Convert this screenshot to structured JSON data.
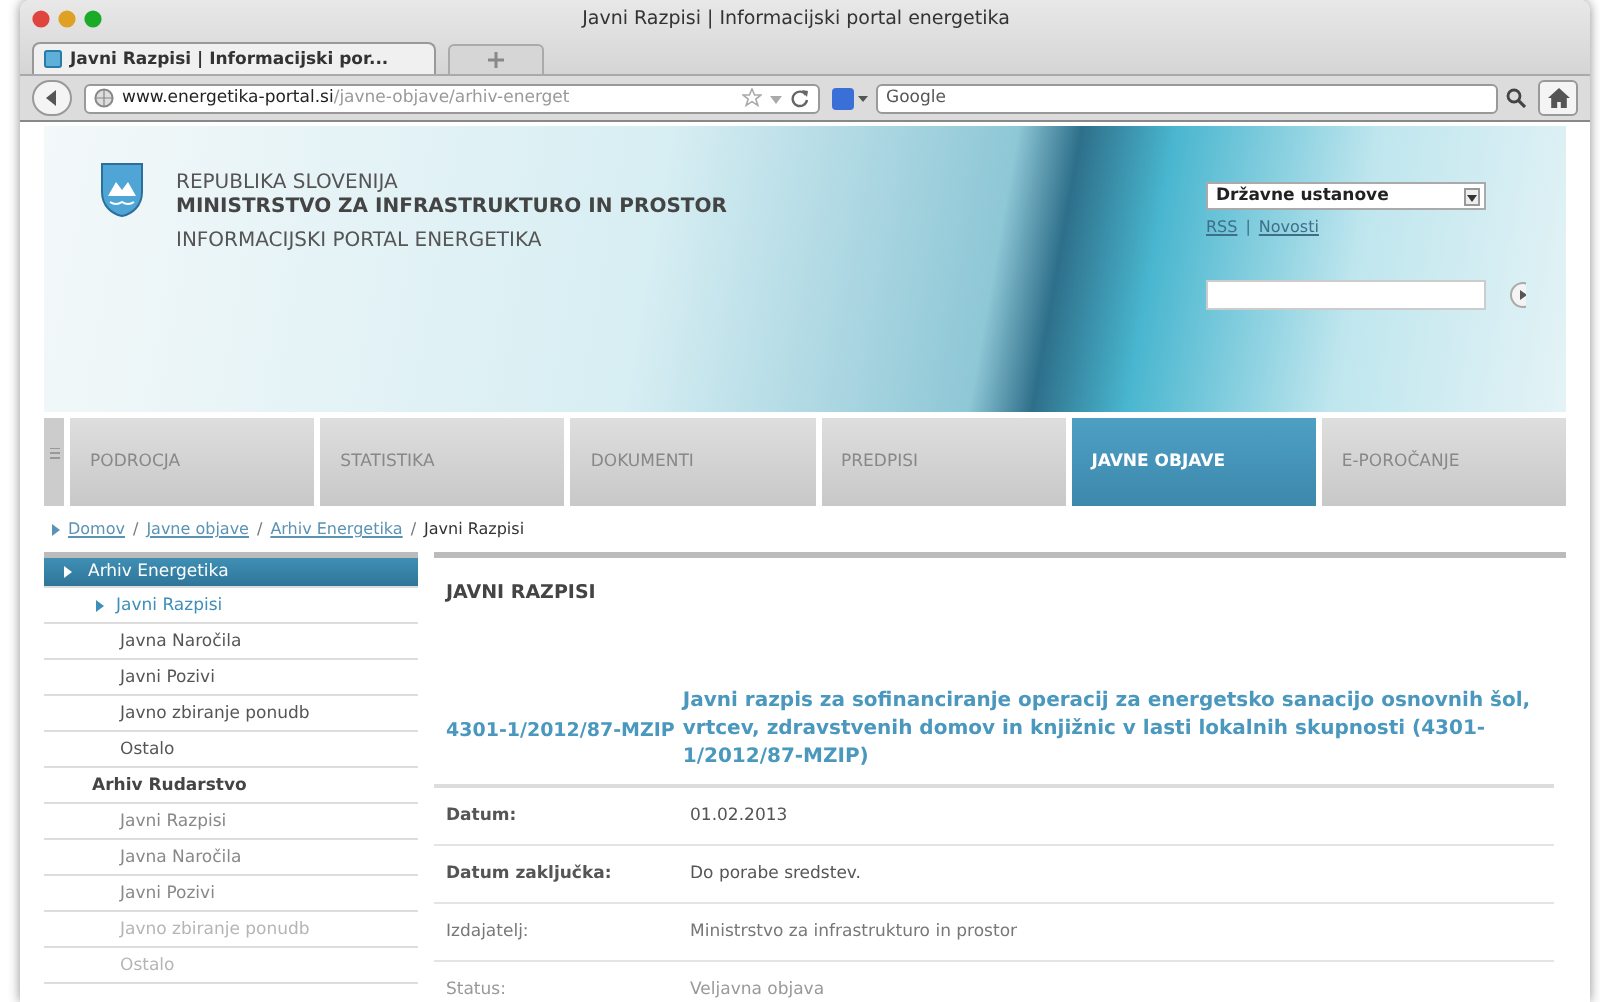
{
  "window": {
    "title": "Javni Razpisi | Informacijski portal energetika"
  },
  "tabs": [
    {
      "label": "Javni Razpisi | Informacijski por...",
      "selected": true
    }
  ],
  "address_bar": {
    "domain": "www.energetika-portal.si",
    "path": "/javne-objave/arhiv-energet"
  },
  "search": {
    "placeholder": "Google"
  },
  "header": {
    "lines": [
      "REPUBLIKA SLOVENIJA",
      "MINISTRSTVO ZA INFRASTRUKTURO IN PROSTOR",
      "INFORMACIJSKI PORTAL ENERGETIKA"
    ],
    "dropdown": "Državne ustanove",
    "links": [
      "RSS",
      "Novosti"
    ],
    "link_separator": "|"
  },
  "breadcrumb_separator": "/",
  "nav": [
    {
      "label": "PODROCJA",
      "selected": false
    },
    {
      "label": "STATISTIKA",
      "selected": false
    },
    {
      "label": "DOKUMENTI",
      "selected": false
    },
    {
      "label": "PREDPISI",
      "selected": false
    },
    {
      "label": "JAVNE OBJAVE",
      "selected": true
    },
    {
      "label": "E-POROČANJE",
      "selected": false
    }
  ],
  "breadcrumb": [
    {
      "label": "Domov",
      "link": true
    },
    {
      "label": "Javne objave",
      "link": true
    },
    {
      "label": "Arhiv Energetika",
      "link": true
    },
    {
      "label": "Javni Razpisi",
      "link": false
    }
  ],
  "sidebar": [
    {
      "label": "Arhiv Energetika",
      "selected": true,
      "children": [
        {
          "label": "Javni Razpisi",
          "selected": true
        },
        {
          "label": "Javna Naročila",
          "selected": false
        },
        {
          "label": "Javni Pozivi",
          "selected": false
        },
        {
          "label": "Javno zbiranje ponudb",
          "selected": false
        },
        {
          "label": "Ostalo",
          "selected": false
        }
      ]
    },
    {
      "label": "Arhiv Rudarstvo",
      "selected": false,
      "children": [
        {
          "label": "Javni Razpisi",
          "selected": false
        },
        {
          "label": "Javna Naročila",
          "selected": false
        },
        {
          "label": "Javni Pozivi",
          "selected": false
        },
        {
          "label": "Javno zbiranje ponudb",
          "selected": false
        },
        {
          "label": "Ostalo",
          "selected": false
        }
      ]
    }
  ],
  "content": {
    "heading": "JAVNI RAZPISI",
    "code": "4301-1/2012/87-MZIP",
    "title": "Javni razpis za sofinanciranje operacij za energetsko sanacijo osnovnih šol, vrtcev, zdravstvenih domov in knjižnic v lasti lokalnih skupnosti (4301-1/2012/87-MZIP)",
    "fields": [
      {
        "label": "Datum:",
        "value": "01.02.2013"
      },
      {
        "label": "Datum zaključka:",
        "value": "Do porabe sredstev."
      },
      {
        "label": "Izdajatelj:",
        "value": "Ministrstvo za infrastrukturo in prostor"
      },
      {
        "label": "Status:",
        "value": "Veljavna objava"
      }
    ]
  }
}
